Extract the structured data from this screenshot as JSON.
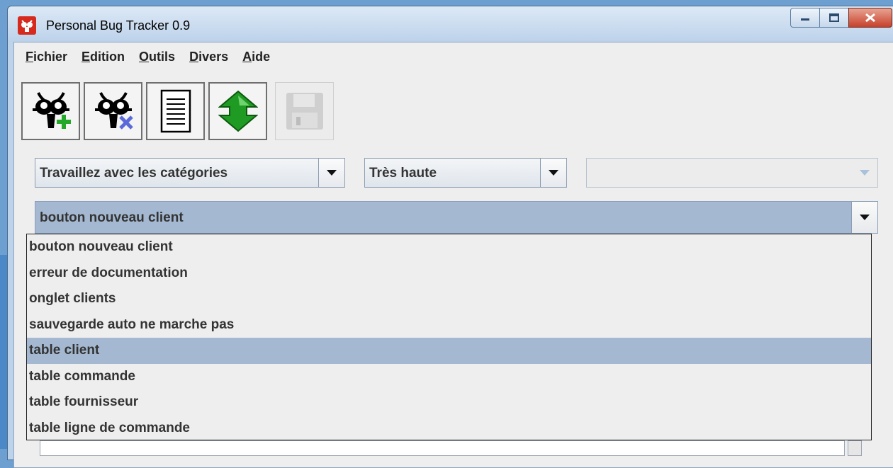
{
  "window": {
    "title": "Personal Bug Tracker 0.9"
  },
  "menu": [
    {
      "mnemonic": "F",
      "rest": "ichier"
    },
    {
      "mnemonic": "E",
      "rest": "dition"
    },
    {
      "mnemonic": "O",
      "rest": "utils"
    },
    {
      "mnemonic": "D",
      "rest": "ivers"
    },
    {
      "mnemonic": "A",
      "rest": "ide"
    }
  ],
  "toolbar": {
    "buttons": [
      {
        "name": "add-bug-button",
        "icon": "bug-add-icon",
        "enabled": true
      },
      {
        "name": "remove-bug-button",
        "icon": "bug-remove-icon",
        "enabled": true
      },
      {
        "name": "document-button",
        "icon": "document-icon",
        "enabled": true
      },
      {
        "name": "sync-button",
        "icon": "up-down-arrow-icon",
        "enabled": true
      },
      {
        "name": "save-button",
        "icon": "floppy-disk-icon",
        "enabled": false
      }
    ]
  },
  "filters": {
    "category": {
      "value": "Travaillez avec les catégories"
    },
    "priority": {
      "value": "Très haute"
    },
    "third": {
      "value": "",
      "enabled": false
    }
  },
  "bug_combo": {
    "value": "bouton nouveau client",
    "options": [
      "bouton nouveau client",
      "erreur de documentation",
      "onglet clients",
      "sauvegarde auto ne marche pas",
      "table client",
      "table commande",
      "table fournisseur",
      "table ligne de commande"
    ],
    "highlighted_index": 4
  },
  "colors": {
    "selection": "#a4b9d1",
    "panel": "#eeeeee",
    "close_button": "#c7402a"
  }
}
